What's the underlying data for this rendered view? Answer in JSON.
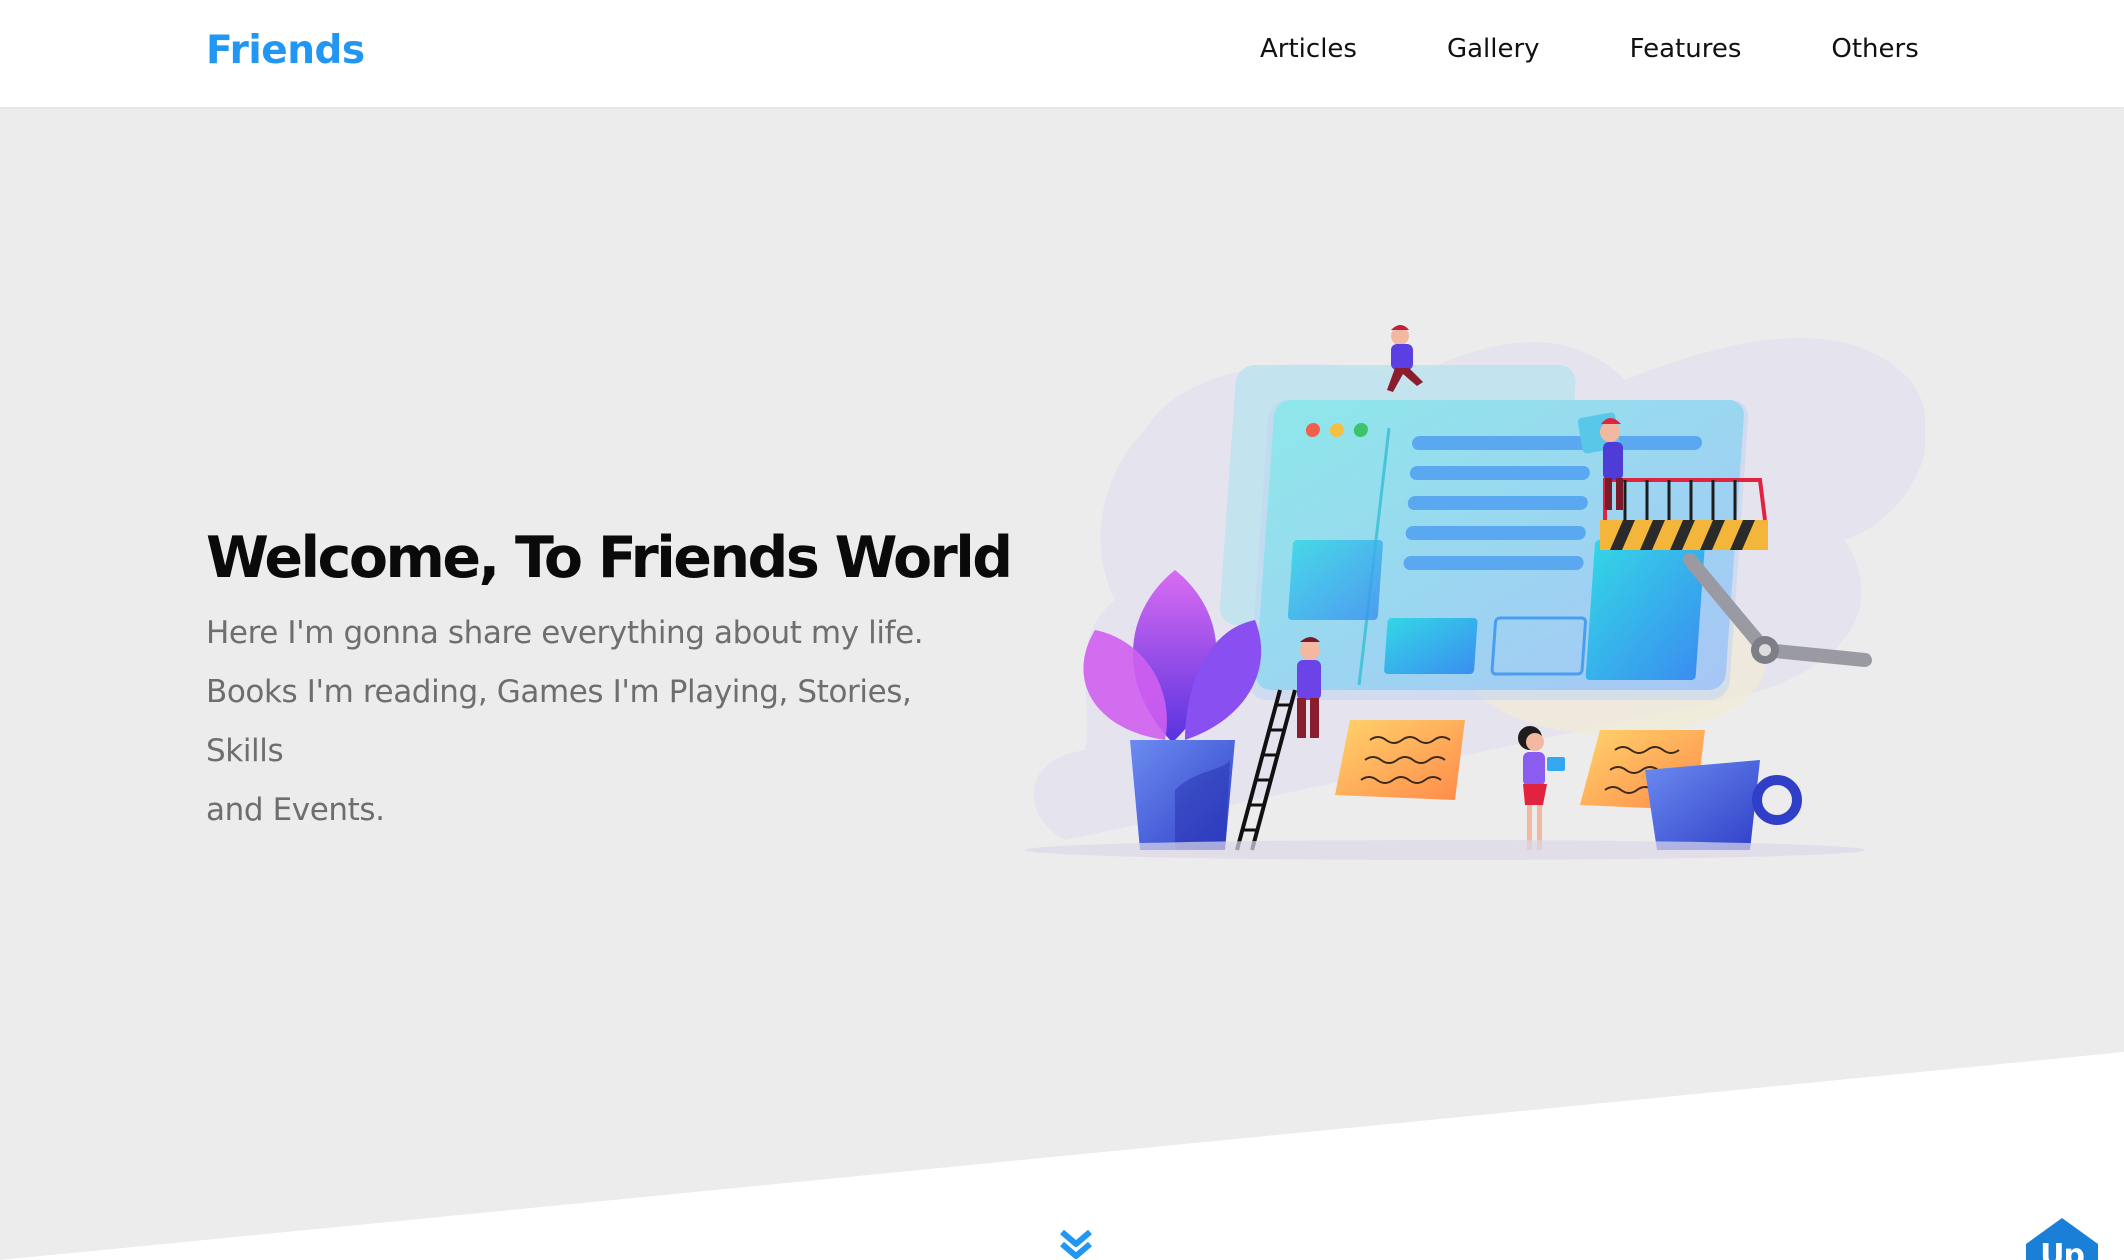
{
  "header": {
    "brand": "Friends",
    "nav": [
      "Articles",
      "Gallery",
      "Features",
      "Others"
    ]
  },
  "hero": {
    "title": "Welcome, To Friends World",
    "lines": [
      "Here I'm gonna share everything about my life.",
      "Books I'm reading, Games I'm Playing, Stories, Skills",
      "and Events."
    ]
  },
  "scroll": {
    "down_icon": "chevron-double-down-icon",
    "up_label": "Up"
  },
  "colors": {
    "accent": "#2196f3",
    "up_button": "#1a7fd6",
    "hero_bg": "#ececec",
    "title": "#0a0a0a",
    "body_text": "#6e6e6e"
  }
}
